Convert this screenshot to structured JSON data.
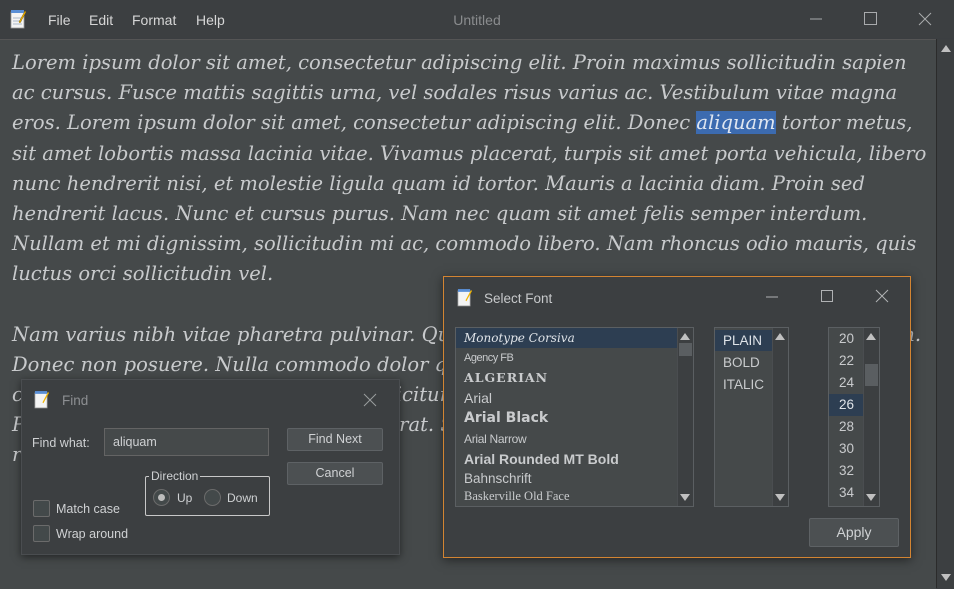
{
  "window": {
    "title": "Untitled",
    "menu": [
      "File",
      "Edit",
      "Format",
      "Help"
    ]
  },
  "editor": {
    "paragraph1_before": "Lorem ipsum dolor sit amet, consectetur adipiscing elit. Proin maximus sollicitudin sapien ac cursus. Fusce mattis sagittis urna, vel sodales risus varius ac. Vestibulum vitae magna eros. Lorem ipsum dolor sit amet, consectetur adipiscing elit. Donec ",
    "paragraph1_highlight": "aliquam",
    "paragraph1_after": " tortor metus, sit amet lobortis massa lacinia vitae. Vivamus placerat, turpis sit amet porta vehicula, libero nunc hendrerit nisi, et molestie ligula quam id tortor. Mauris a lacinia diam. Proin sed hendrerit lacus. Nunc et cursus purus. Nam nec quam sit amet felis semper interdum. Nullam et mi dignissim, sollicitudin mi ac, commodo libero. Nam rhoncus odio mauris, quis luctus orci sollicitudin vel.",
    "paragraph2": "Nam varius nibh vitae pharetra pulvinar. Quisque vitae lectus ut justo tincidunt fermentum. Donec non posuere. Nulla commodo dolor quis euismod dictum. Sed vitae tortor at velit commodo dignissim. Donec facilisis efficitur ullamcorper. Pellentesque at velit lectus. Praesent in luctus ante, vel hendrerit erat. Suspendisse potenti. Suspendisse ut tempor risus. Donec venenatis"
  },
  "find_dialog": {
    "title": "Find",
    "find_what_label": "Find what:",
    "find_what_value": "aliquam",
    "find_next": "Find Next",
    "cancel": "Cancel",
    "direction_label": "Direction",
    "up": "Up",
    "down": "Down",
    "match_case": "Match case",
    "wrap_around": "Wrap around"
  },
  "font_dialog": {
    "title": "Select Font",
    "fonts": [
      "Monotype Corsiva",
      "Agency FB",
      "ALGERIAN",
      "Arial",
      "Arial Black",
      "Arial Narrow",
      "Arial Rounded MT Bold",
      "Bahnschrift",
      "Baskerville Old Face"
    ],
    "styles": [
      "PLAIN",
      "BOLD",
      "ITALIC"
    ],
    "sizes": [
      "20",
      "22",
      "24",
      "26",
      "28",
      "30",
      "32",
      "34"
    ],
    "apply": "Apply"
  },
  "colors": {
    "background": "#3c3f41",
    "editor_bg": "#45494a",
    "selection": "#3c6bb0",
    "focus_border": "#d38432"
  }
}
